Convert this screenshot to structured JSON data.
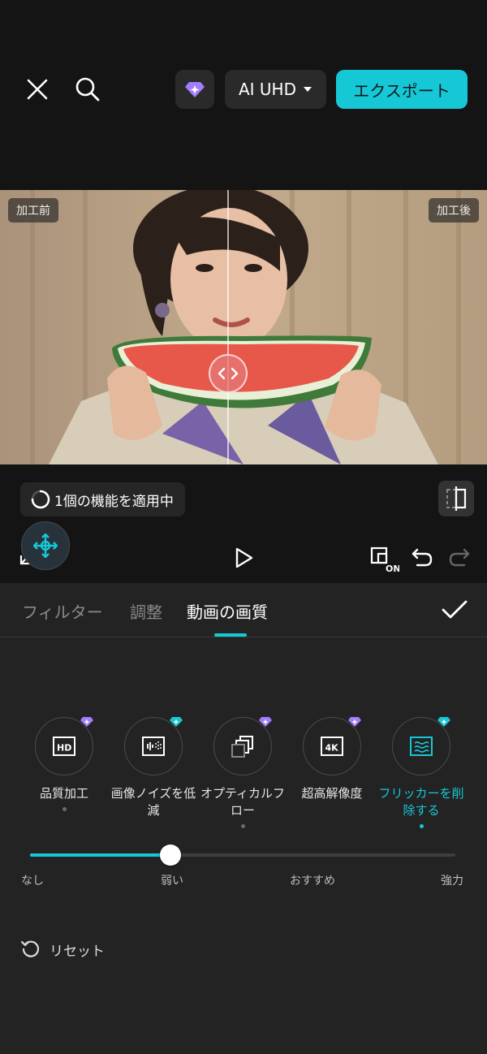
{
  "header": {
    "upgrade_quality": "AI UHD",
    "export_label": "エクスポート"
  },
  "video": {
    "before_label": "加工前",
    "after_label": "加工後"
  },
  "player": {
    "status_text": "1個の機能を適用中"
  },
  "tabs": [
    {
      "label": "フィルター"
    },
    {
      "label": "調整"
    },
    {
      "label": "動画の画質"
    }
  ],
  "tools": [
    {
      "label": "品質加工",
      "icon": "hd-icon"
    },
    {
      "label": "画像ノイズを低減",
      "icon": "noise-reduce-icon"
    },
    {
      "label": "オプティカルフロー",
      "icon": "optical-flow-icon"
    },
    {
      "label": "超高解像度",
      "icon": "4k-icon"
    },
    {
      "label": "フリッカーを削除する",
      "icon": "flicker-icon"
    }
  ],
  "intensity": {
    "levels": [
      "なし",
      "弱い",
      "おすすめ",
      "強力"
    ],
    "selected": "弱い",
    "position_fraction": 0.33
  },
  "reset_label": "リセット",
  "colors": {
    "accent": "#16c8d6",
    "premium": "#a27dff",
    "background": "#141414",
    "panel": "#232323"
  }
}
